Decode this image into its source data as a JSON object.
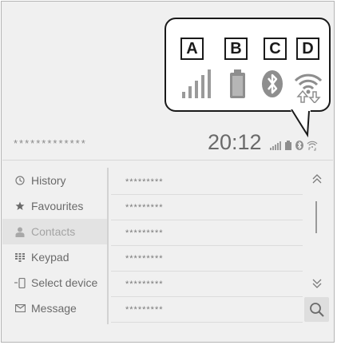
{
  "callout": {
    "letters": [
      "A",
      "B",
      "C",
      "D"
    ],
    "icons": [
      "signal-strength-icon",
      "battery-icon",
      "bluetooth-icon",
      "wifi-transfer-icon"
    ]
  },
  "status_bar": {
    "device_name": "*************",
    "time": "20:12",
    "icons": [
      "signal-strength-icon",
      "battery-icon",
      "bluetooth-icon",
      "wifi-transfer-icon"
    ]
  },
  "menu": {
    "items": [
      {
        "label": "History",
        "icon": "clock-icon"
      },
      {
        "label": "Favourites",
        "icon": "star-icon"
      },
      {
        "label": "Contacts",
        "icon": "person-icon",
        "active": true
      },
      {
        "label": "Keypad",
        "icon": "keypad-icon"
      },
      {
        "label": "Select device",
        "icon": "phone-device-icon"
      },
      {
        "label": "Message",
        "icon": "envelope-icon"
      }
    ]
  },
  "contacts": {
    "rows": [
      "*********",
      "*********",
      "*********",
      "*********",
      "*********",
      "*********"
    ]
  },
  "controls": {
    "scroll_up": "⌃⌃",
    "scroll_down": "⌄⌄",
    "search_icon": "search-icon"
  }
}
